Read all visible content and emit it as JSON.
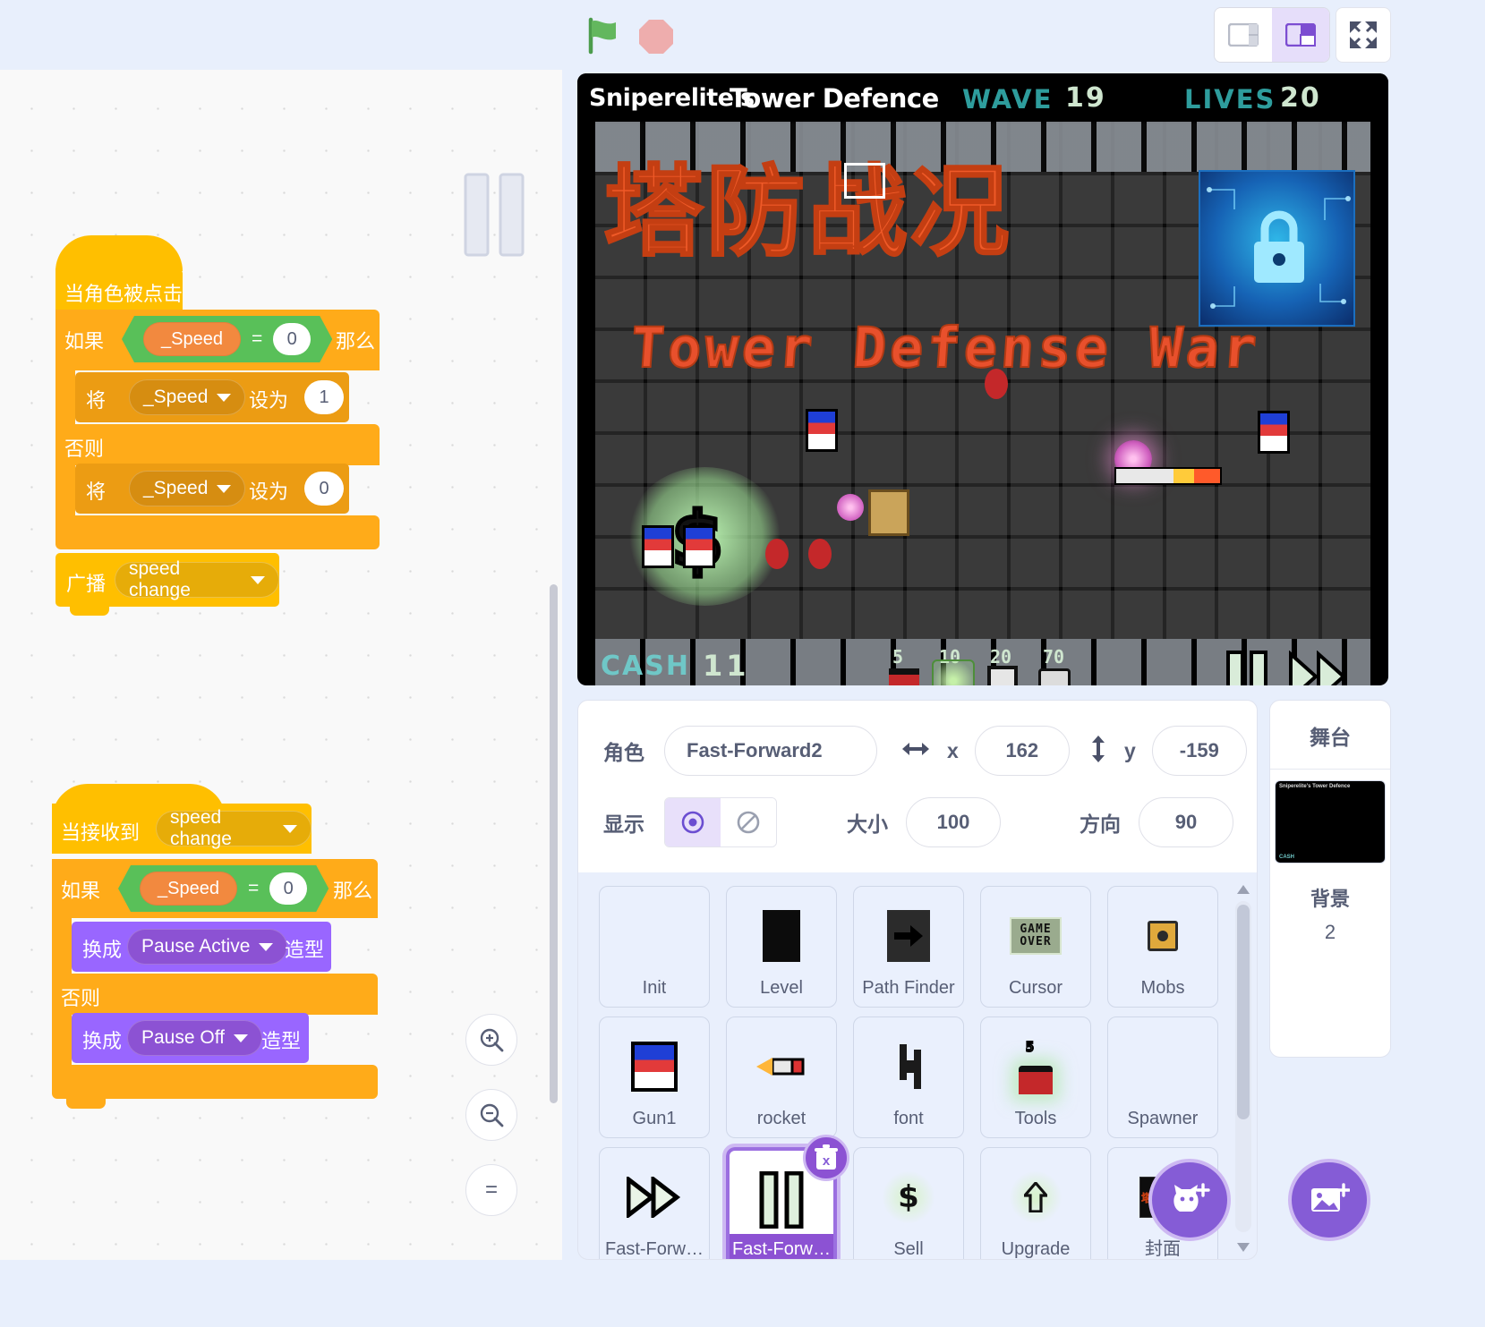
{
  "toolbar": {
    "green_flag_label": "green-flag",
    "stop_label": "stop",
    "layout_small_label": "small-stage-layout",
    "layout_large_label": "large-stage-layout",
    "fullscreen_label": "fullscreen"
  },
  "code": {
    "script1": {
      "hat": "当角色被点击",
      "if_label": "如果",
      "then_label": "那么",
      "else_label": "否则",
      "cond_var": "_Speed",
      "cond_op": "=",
      "cond_val": "0",
      "set_label": "将",
      "set_to_label": "设为",
      "set_var": "_Speed",
      "set_val_then": "1",
      "set_val_else": "0",
      "broadcast_label": "广播",
      "broadcast_msg": "speed change"
    },
    "script2": {
      "hat": "当接收到",
      "hat_msg": "speed change",
      "if_label": "如果",
      "then_label": "那么",
      "else_label": "否则",
      "cond_var": "_Speed",
      "cond_op": "=",
      "cond_val": "0",
      "switch_label": "换成",
      "costume_label": "造型",
      "costume_then": "Pause Active",
      "costume_else": "Pause Off"
    },
    "zoom_in": "zoom-in",
    "zoom_out": "zoom-out",
    "zoom_reset": "="
  },
  "stage": {
    "owner": "Sniperelite's",
    "title": "Tower Defence",
    "wave_label": "WAVE",
    "wave_value": "19",
    "lives_label": "LIVES",
    "lives_value": "20",
    "game_title_cn": "塔防战况",
    "game_title_en": "Tower Defense War",
    "cash_label": "CASH",
    "cash_value": "11",
    "tower_prices": [
      "5",
      "10",
      "20",
      "70"
    ]
  },
  "sprite_info": {
    "name_label": "角色",
    "name_value": "Fast-Forward2",
    "x_label": "x",
    "x_value": "162",
    "y_label": "y",
    "y_value": "-159",
    "show_label": "显示",
    "size_label": "大小",
    "size_value": "100",
    "direction_label": "方向",
    "direction_value": "90"
  },
  "sprite_list": [
    {
      "name": "Init",
      "icon": "blank-icon"
    },
    {
      "name": "Level",
      "icon": "black-square-icon"
    },
    {
      "name": "Path Finder",
      "icon": "arrow-right-icon"
    },
    {
      "name": "Cursor",
      "icon": "game-over-icon"
    },
    {
      "name": "Mobs",
      "icon": "mob-icon"
    },
    {
      "name": "Gun1",
      "icon": "gun-icon"
    },
    {
      "name": "rocket",
      "icon": "rocket-icon"
    },
    {
      "name": "font",
      "icon": "font-icon"
    },
    {
      "name": "Tools",
      "icon": "tools-icon"
    },
    {
      "name": "Spawner",
      "icon": "blank-icon"
    },
    {
      "name": "Fast-Forw…",
      "icon": "fast-forward-icon"
    },
    {
      "name": "Fast-Forw…",
      "icon": "pause-icon",
      "selected": true,
      "delete_label": "×"
    },
    {
      "name": "Sell",
      "icon": "dollar-icon"
    },
    {
      "name": "Upgrade",
      "icon": "upgrade-arrow-icon"
    },
    {
      "name": "封面",
      "icon": "cover-icon"
    }
  ],
  "stage_panel": {
    "title": "舞台",
    "backdrop_label": "背景",
    "backdrop_count": "2",
    "thumb_header": "Sniperelite's Tower Defence",
    "thumb_cash": "CASH"
  },
  "fabs": {
    "add_sprite": "add-sprite",
    "add_backdrop": "add-backdrop"
  },
  "colors": {
    "accent_purple": "#855cd6",
    "events_yellow": "#ffbf00",
    "control_orange": "#ffab19",
    "operators_green": "#59c059",
    "looks_purple": "#9966ff",
    "variables_orange": "#f2893f",
    "app_bg": "#e8effc"
  }
}
